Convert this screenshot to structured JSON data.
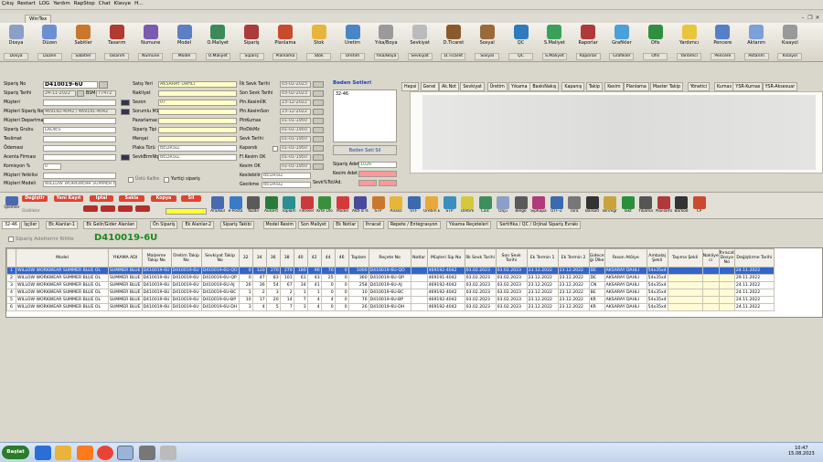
{
  "titlebar": {
    "menus": [
      "Çıkış",
      "Restart",
      "LOG",
      "Yardım",
      "RapStop",
      "Chat",
      "Klavye",
      "H..."
    ]
  },
  "window": {
    "tab": "WinTex"
  },
  "toolbar": [
    {
      "label": "Dosya",
      "dd": "Dosya"
    },
    {
      "label": "Düzen",
      "dd": "Düzen"
    },
    {
      "label": "Sabitler",
      "dd": "Sabitler"
    },
    {
      "label": "Tasarım",
      "dd": "Tasarım"
    },
    {
      "label": "Numune",
      "dd": "Numune"
    },
    {
      "label": "Model",
      "dd": "Model"
    },
    {
      "label": "Ö.Maliyet",
      "dd": "Ö.Maliyet"
    },
    {
      "label": "Sipariş",
      "dd": "Sipariş"
    },
    {
      "label": "Planlama",
      "dd": "Planlama"
    },
    {
      "label": "Stok",
      "dd": "Stok"
    },
    {
      "label": "Üretim",
      "dd": "Üretim"
    },
    {
      "label": "Yıka/Boya",
      "dd": "Yıka/Boya"
    },
    {
      "label": "Sevkiyat",
      "dd": "Sevkiyat"
    },
    {
      "label": "D.Ticaret",
      "dd": "D.Ticaret"
    },
    {
      "label": "Sosyal",
      "dd": "Sosyal"
    },
    {
      "label": "QC",
      "dd": "QC"
    },
    {
      "label": "S.Maliyet",
      "dd": "S.Maliyet"
    },
    {
      "label": "Raporlar",
      "dd": "Raporlar"
    },
    {
      "label": "Grafikler",
      "dd": "Grafikler"
    },
    {
      "label": "Ofis",
      "dd": "Ofis"
    },
    {
      "label": "Yardımcı",
      "dd": "Yardımcı"
    },
    {
      "label": "Pencere",
      "dd": "Pencere"
    },
    {
      "label": "Aktarım",
      "dd": "Aktarım"
    },
    {
      "label": "Kısayol",
      "dd": "Kısayol"
    }
  ],
  "form": {
    "siparis_no_label": "Sipariş No",
    "siparis_no": "D410019-6U",
    "siparis_tarihi_label": "Sipariş Tarihi",
    "siparis_tarihi": "24-11-2022",
    "bsm_label": "BSM",
    "bsm": "77472",
    "musteri_label": "Müşteri",
    "musteri_siparis_no_label": "Müşteri Sipariş No",
    "musteri_siparis_no": "469192-4042 / 469191-4042",
    "musteri_departmani_label": "Müşteri Departmanı",
    "siparis_grubu_label": "Sipariş Grubu",
    "siparis_grubu": "LADIES",
    "teslimat_label": "Teslimat",
    "odemesi_label": "Ödemesi",
    "acenta_firmasi_label": "Acenta Firması",
    "komisyon_label": "Komisyon %",
    "komisyon": "0",
    "musteri_yetkilisi_label": "Müşteri Yetkilisi",
    "musteri_modeli_label": "Müşteri Modeli",
    "musteri_modeli": "WILLOW WORKWEAR SUMMER BL",
    "satis_yeri_label": "Satış Yeri",
    "satis_yeri": "AKSARAY DAHLI",
    "nakliyat_label": "Nakliyat",
    "sezon_label": "Sezon",
    "sezon": "07",
    "sorumlu_label": "Sorumlu M1",
    "pazarlamaci_label": "Pazarlamacı",
    "siparis_tipi_label": "Sipariş Tipi",
    "mensei_label": "Menşei",
    "plaka_label": "Plaka Türü",
    "plaka": "BELIRSIZ",
    "sevk_label": "SevkBrmNtp",
    "sevk": "BELIRSIZ",
    "ustu_label": "Üstü Kalite",
    "yurtici_label": "Yurtiçi sipariş",
    "ilk_sevk_label": "İlk Sevk Tarihi",
    "ilk_sevk": "03-02-2023",
    "son_sevk_label": "Son Sevk Tarihi",
    "son_sevk": "03-02-2023",
    "plnkesimilk_label": "Pln.KesimİlK",
    "plnkesimilk": "23-12-2022",
    "plnkesimson_label": "Pln.KesimSon",
    "plnkesimson": "23-12-2022",
    "plnkumas_label": "PlnKumas",
    "plnkumas": "01-01-1950",
    "plndikmz_label": "PlnDikMz",
    "plndikmz": "01-01-1950",
    "sevk_tarihi_label": "Sevk Tarihi",
    "sevk_tarihi": "01-01-1950",
    "kapandi_label": "Kapandı",
    "kapandi": "01-01-1950",
    "flkesimok_label": "Fl.Kesim OK",
    "flkesimok": "01-01-1950",
    "kesimok_label": "Kesim OK",
    "kesimok": "01-01-1950",
    "kesiltilebilir_label": "Kesilebilir",
    "kesiltilebilir": "BELIRSIZ",
    "gecikme_label": "Gecikme",
    "gecikme": "BELIRSIZ",
    "beden_title": "Beden Setleri",
    "beden_item": "32-46",
    "beden_btn": "Beden Seti Sil",
    "siparis_adet_label": "Sipariş Adet",
    "siparis_adet": "1026",
    "kesim_adet_label": "Kesim Adet",
    "sevk_tol_label": "Sevk%Tol/Ad."
  },
  "right_tabs": [
    "Hepsi",
    "Genel",
    "Ak.Not",
    "Sevkiyat",
    "Üretim",
    "Yıkama",
    "BaskıNakış",
    "Kapanış",
    "Takip",
    "Kesim",
    "Planlama",
    "Master Takip",
    "Yönetici",
    "Kumas",
    "YSR-Kumas",
    "YSR-Aksesuar"
  ],
  "action_bar": {
    "nav": [
      "Değiştir",
      "Yeni Kayıt",
      "İptal",
      "Sakla",
      "Kopya",
      "Sil"
    ],
    "islemler": "İşlemler",
    "gizlilikler": "Gizlilikler",
    "icons": [
      "Ara/Bul",
      "e-Posta",
      "Yazdır",
      "AutoFit",
      "Toplam",
      "Filtreler",
      "Krte Olo",
      "Model",
      "AktFlz Rz",
      "STP",
      "Analiz",
      "UTF",
      "Uretim Em",
      "STP",
      "Üretim",
      "Calc",
      "Ölçü",
      "Belge",
      "SipKapa",
      "UTF-2",
      "Tara",
      "Barkod",
      "Birimgr",
      "Takt",
      "Yıkama",
      "Planlama",
      "Barkod",
      "CP"
    ]
  },
  "order_tabs": [
    "32-46",
    "İşçiler",
    "Ek Alanlar-1",
    "Ek Gelir/Gider Alanları",
    "Ön Sipariş",
    "Ek Alanlar-2",
    "Sipariş Takibi",
    "Model Resim",
    "Son Maliyet",
    "Ek Notlar",
    "İhracat",
    "Repete / Entegrasyon",
    "Yıkama Reçeteleri",
    "Sertifika / QC / Orjinal Sipariş Evrakı"
  ],
  "grid": {
    "lock_label": "Sipariş Adetlerini Kilitle",
    "order_code": "D410019-6U",
    "headers": [
      "",
      "Model",
      "YIKAMA ADI",
      "Malzeme Takip No",
      "Üretim Takip No",
      "Sevkiyat Takip No",
      "32",
      "34",
      "36",
      "38",
      "40",
      "42",
      "44",
      "46",
      "Toplam",
      "Reçete No",
      "Notlar",
      "Müşteri Sip No",
      "İlk Sevk Tarihi",
      "Son Sevk Tarihi",
      "Ek Termin 1",
      "Ek Termin 2",
      "Gidece ği Ülke",
      "Fason Atölye",
      "Ambalaj Şekli",
      "Taşıma Şekli",
      "Nakliye ci",
      "İhracat Dosya No",
      "Değiştirme Tarihi"
    ],
    "rows": [
      [
        "1",
        "WILLOW WORKWEAR SUMMER BLUE OL",
        "SUMMER BLUE",
        "D410019-6U",
        "D410019-6U",
        "D410019-6U-QO",
        "0",
        "120",
        "270",
        "270",
        "180",
        "90",
        "70",
        "0",
        "1000",
        "D410019-6U-QO",
        "",
        "469192-4042",
        "03.02.2023",
        "03.02.2023",
        "23.12.2022",
        "23.12.2022",
        "DE",
        "AKSARAY DAHLI",
        "54x35x4",
        "",
        "",
        "",
        "24.11.2022"
      ],
      [
        "2",
        "WILLOW WORKWEAR SUMMER BLUE OL",
        "SUMMER BLUE",
        "D410019-6U",
        "D410019-6U",
        "D410019-6U-QP",
        "0",
        "47",
        "83",
        "101",
        "61",
        "43",
        "25",
        "0",
        "360",
        "D410019-6U-QP",
        "",
        "469191-4042",
        "03.02.2023",
        "03.02.2023",
        "23.12.2022",
        "23.12.2022",
        "DE",
        "AKSARAY DAHLI",
        "54x35x4",
        "",
        "",
        "",
        "29.11.2022"
      ],
      [
        "3",
        "WILLOW WORKWEAR SUMMER BLUE OL",
        "SUMMER BLUE",
        "D410019-6U",
        "D410019-6U",
        "D410019-6U-AJ",
        "26",
        "36",
        "54",
        "67",
        "34",
        "41",
        "0",
        "0",
        "258",
        "D410019-6U-AJ",
        "",
        "469192-4042",
        "03.02.2023",
        "03.02.2023",
        "23.12.2022",
        "23.12.2022",
        "CN",
        "AKSARAY DAHLI",
        "54x35x4",
        "",
        "",
        "",
        "24.11.2022"
      ],
      [
        "4",
        "WILLOW WORKWEAR SUMMER BLUE OL",
        "SUMMER BLUE",
        "D410019-6U",
        "D410019-6U",
        "D410019-6U-BC",
        "1",
        "2",
        "3",
        "2",
        "1",
        "1",
        "0",
        "0",
        "10",
        "D410019-6U-BC",
        "",
        "469192-4042",
        "03.02.2023",
        "03.02.2023",
        "23.12.2022",
        "23.12.2022",
        "BE",
        "AKSARAY DAHLI",
        "54x35x4",
        "",
        "",
        "",
        "24.11.2022"
      ],
      [
        "5",
        "WILLOW WORKWEAR SUMMER BLUE OL",
        "SUMMER BLUE",
        "D410019-6U",
        "D410019-6U",
        "D410019-6U-BP",
        "10",
        "17",
        "20",
        "14",
        "7",
        "4",
        "4",
        "0",
        "76",
        "D410019-6U-BP",
        "",
        "469192-4042",
        "03.02.2023",
        "03.02.2023",
        "23.12.2022",
        "23.12.2022",
        "KR",
        "AKSARAY DAHLI",
        "54x35x4",
        "",
        "",
        "",
        "24.11.2022"
      ],
      [
        "6",
        "WILLOW WORKWEAR SUMMER BLUE OL",
        "SUMMER BLUE",
        "D410019-6U",
        "D410019-6U",
        "D410019-6U-DH",
        "3",
        "4",
        "5",
        "7",
        "3",
        "4",
        "0",
        "0",
        "26",
        "D410019-6U-DH",
        "",
        "469192-4042",
        "03.02.2023",
        "03.02.2023",
        "23.12.2022",
        "23.12.2022",
        "KR",
        "AKSARAY DAHLI",
        "54x35x4",
        "",
        "",
        "",
        "24.11.2022"
      ]
    ]
  },
  "taskbar": {
    "start": "Başlat",
    "time": "10:47",
    "date": "15.08.2023"
  },
  "colors": {
    "accent": "#3366cc",
    "field_yellow": "#ffffc6",
    "red_field": "#ff9a9a",
    "order_green": "#1d8a1d"
  }
}
